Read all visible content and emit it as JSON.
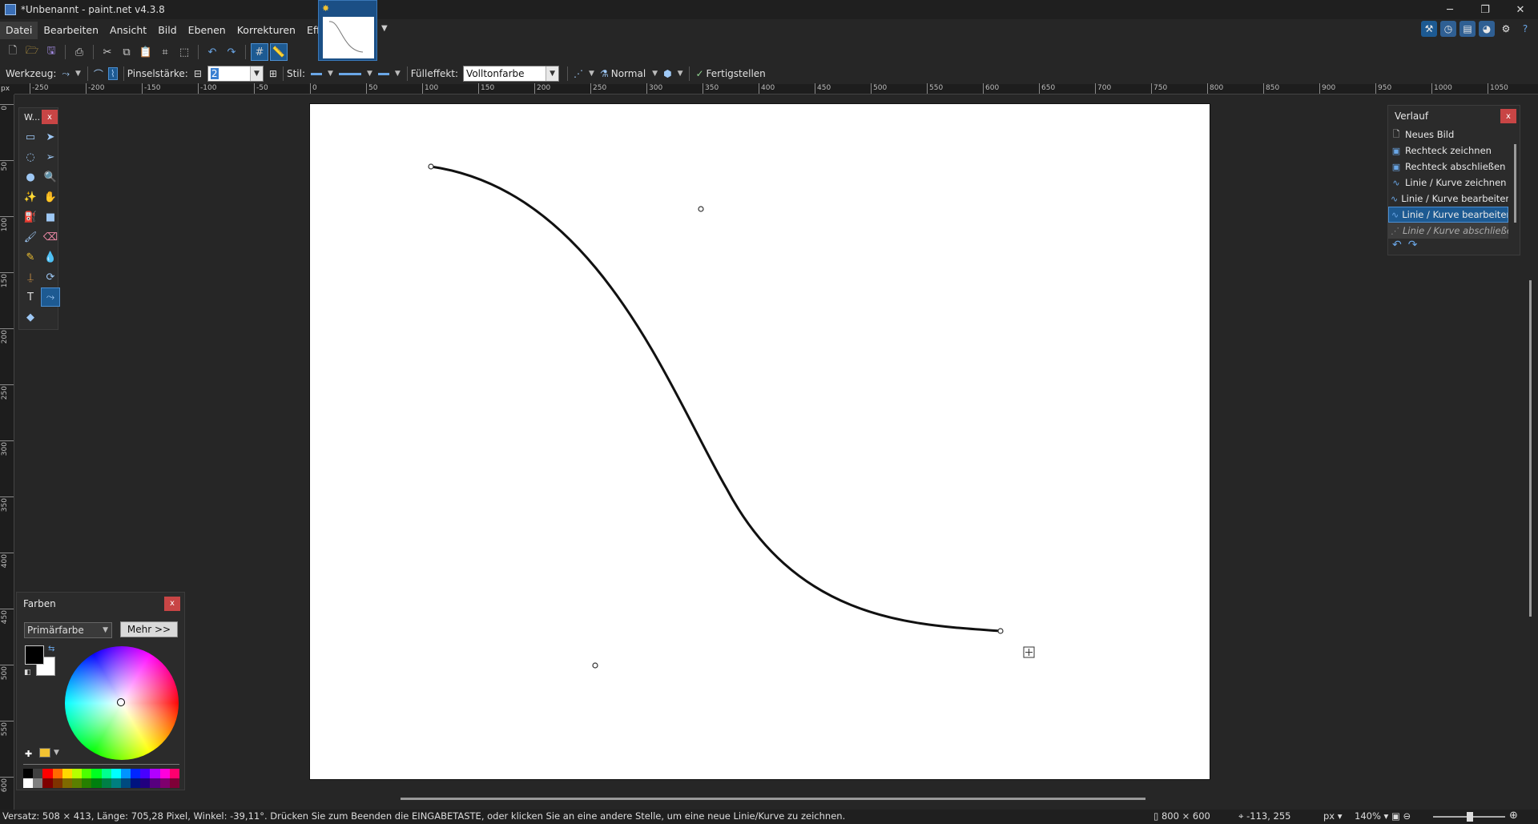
{
  "window": {
    "title": "*Unbenannt - paint.net v4.3.8",
    "controls": [
      "─",
      "❐",
      "✕"
    ]
  },
  "menu": [
    "Datei",
    "Bearbeiten",
    "Ansicht",
    "Bild",
    "Ebenen",
    "Korrekturen",
    "Effekte"
  ],
  "toolbar": {
    "tool_label": "Werkzeug:",
    "brush_label": "Pinselstärke:",
    "brush_value": "2",
    "style_label": "Stil:",
    "fill_label": "Fülleffekt:",
    "fill_value": "Volltonfarbe",
    "blend_value": "Normal",
    "finish_label": "Fertigstellen"
  },
  "rulers": {
    "unit": "px",
    "h_ticks": [
      "-250",
      "-200",
      "-150",
      "-100",
      "-50",
      "0",
      "50",
      "100",
      "150",
      "200",
      "250",
      "300",
      "350",
      "400",
      "450",
      "500",
      "550",
      "600",
      "650",
      "700",
      "750",
      "800",
      "850",
      "900",
      "950",
      "1000",
      "1050"
    ],
    "v_ticks": [
      "0",
      "50",
      "100",
      "150",
      "200",
      "250",
      "300",
      "350",
      "400",
      "450",
      "500",
      "550",
      "600"
    ]
  },
  "tools_window": {
    "title": "W..."
  },
  "colors_window": {
    "title": "Farben",
    "select_value": "Primärfarbe",
    "more_label": "Mehr >>",
    "primary": "#000000",
    "secondary": "#ffffff"
  },
  "history_window": {
    "title": "Verlauf",
    "items": [
      {
        "label": "Neues Bild",
        "icon": "new-image-icon",
        "state": "done"
      },
      {
        "label": "Rechteck zeichnen",
        "icon": "rectangle-icon",
        "state": "done"
      },
      {
        "label": "Rechteck abschließen",
        "icon": "rectangle-finish-icon",
        "state": "done"
      },
      {
        "label": "Linie / Kurve zeichnen",
        "icon": "curve-icon",
        "state": "done"
      },
      {
        "label": "Linie / Kurve bearbeiten",
        "icon": "curve-icon",
        "state": "done"
      },
      {
        "label": "Linie / Kurve bearbeiten",
        "icon": "curve-icon",
        "state": "selected"
      },
      {
        "label": "Linie / Kurve abschließen",
        "icon": "curve-finish-icon",
        "state": "future"
      }
    ]
  },
  "status": {
    "message": "Versatz: 508 × 413, Länge: 705,28 Pixel, Winkel: -39,11°. Drücken Sie zum Beenden die EINGABETASTE, oder klicken Sie an eine andere Stelle, um eine neue Linie/Kurve zu zeichnen.",
    "image_size": "800 × 600",
    "cursor_pos": "-113, 255",
    "unit": "px",
    "zoom": "140%"
  },
  "palette": [
    "#000000",
    "#404040",
    "#ff0000",
    "#ff6a00",
    "#ffd800",
    "#b6ff00",
    "#4cff00",
    "#00ff21",
    "#00ff90",
    "#00ffff",
    "#0094ff",
    "#0026ff",
    "#4800ff",
    "#b200ff",
    "#ff00dc",
    "#ff006e",
    "#ffffff",
    "#808080",
    "#7f0000",
    "#7f3300",
    "#7f6a00",
    "#5b7f00",
    "#267f00",
    "#007f0e",
    "#007f46",
    "#007f7f",
    "#004a7f",
    "#00137f",
    "#21007f",
    "#57007f",
    "#7f006e",
    "#7f0037"
  ]
}
